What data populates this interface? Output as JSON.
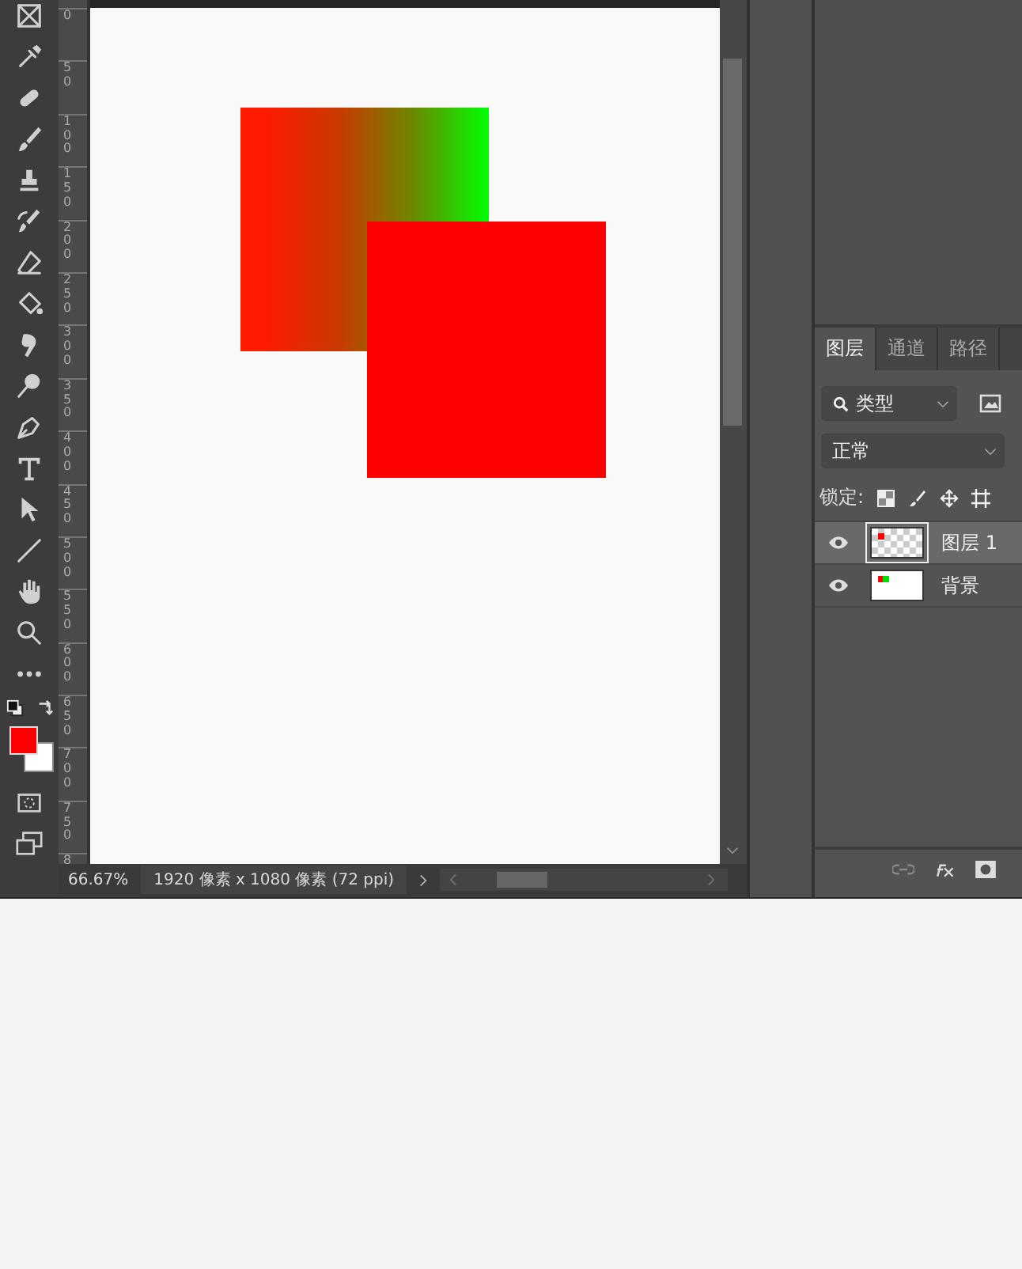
{
  "ruler": {
    "labels": [
      "0",
      "50",
      "100",
      "150",
      "200",
      "250",
      "300",
      "350",
      "400",
      "450",
      "500",
      "550",
      "600",
      "650",
      "700",
      "750",
      "8"
    ]
  },
  "swatches": [
    {
      "kind": "foreground",
      "color": "#ff0000"
    },
    {
      "kind": "background",
      "color": "#ffffff"
    }
  ],
  "status_bar": {
    "zoom": "66.67%",
    "doc_info": "1920 像素 x 1080 像素 (72 ppi)"
  },
  "panel": {
    "tabs": [
      {
        "label": "图层",
        "selected": true
      },
      {
        "label": "通道",
        "selected": false
      },
      {
        "label": "路径",
        "selected": false
      }
    ],
    "filter": {
      "value": "类型"
    },
    "blend_mode": {
      "value": "正常"
    },
    "lock_label": "锁定:",
    "layers": [
      {
        "name": "图层 1",
        "visible": true,
        "selected": true,
        "kind": "transparent"
      },
      {
        "name": "背景",
        "visible": true,
        "selected": false,
        "kind": "solid"
      }
    ]
  }
}
